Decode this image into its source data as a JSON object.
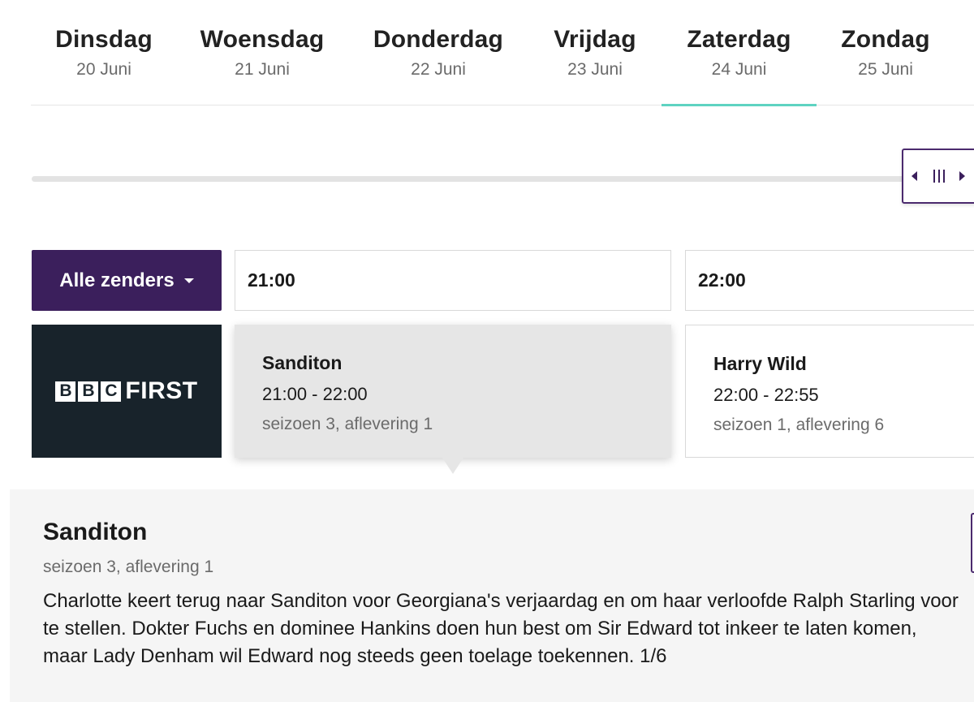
{
  "days": [
    {
      "name": "Dinsdag",
      "date": "20 Juni"
    },
    {
      "name": "Woensdag",
      "date": "21 Juni"
    },
    {
      "name": "Donderdag",
      "date": "22 Juni"
    },
    {
      "name": "Vrijdag",
      "date": "23 Juni"
    },
    {
      "name": "Zaterdag",
      "date": "24 Juni",
      "active": true
    },
    {
      "name": "Zondag",
      "date": "25 Juni"
    }
  ],
  "channels_button": {
    "label": "Alle zenders"
  },
  "time_slots": [
    "21:00",
    "22:00"
  ],
  "channel": {
    "logo_boxes": [
      "B",
      "B",
      "C"
    ],
    "logo_text": "FIRST"
  },
  "programs": [
    {
      "title": "Sanditon",
      "time": "21:00 - 22:00",
      "episode": "seizoen 3, aflevering 1",
      "selected": true
    },
    {
      "title": "Harry Wild",
      "time": "22:00 - 22:55",
      "episode": "seizoen 1, aflevering 6"
    }
  ],
  "detail": {
    "title": "Sanditon",
    "episode": "seizoen 3, aflevering 1",
    "description": "Charlotte keert terug naar Sanditon voor Georgiana's verjaardag en om haar verloofde Ralph Starling voor te stellen. Dokter Fuchs en dominee Hankins doen hun best om Sir Edward tot inkeer te laten komen, maar Lady Denham wil Edward nog steeds geen toelage toekennen. 1/6"
  },
  "colors": {
    "accent": "#3b1f5c",
    "active_underline": "#5fd3c1",
    "channel_bg": "#18232b"
  },
  "icons": {
    "scroll_left": "caret-left-icon",
    "scroll_grip": "grip-icon",
    "scroll_right": "caret-right-icon",
    "dropdown": "caret-down-icon"
  }
}
